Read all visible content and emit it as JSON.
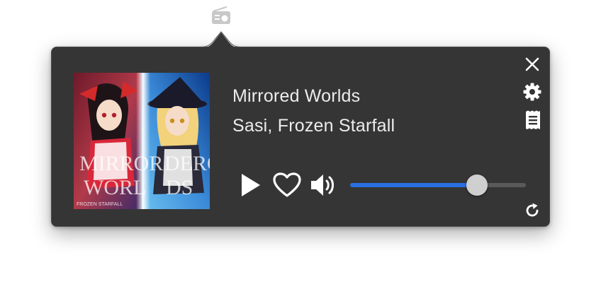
{
  "menubar": {
    "icon": "radio-icon"
  },
  "player": {
    "album_art": {
      "icon": "album-art",
      "text_left": "MIRROR",
      "text_right": "DERO",
      "text_bottom_left": "WORL",
      "text_bottom_right": "DS",
      "label": "FROZEN STARFALL"
    },
    "track_title": "Mirrored Worlds",
    "track_artist": "Sasi, Frozen Starfall",
    "controls": {
      "play_icon": "play-icon",
      "like_icon": "heart-icon",
      "volume_icon": "speaker-icon"
    },
    "volume": {
      "fraction": 0.72
    },
    "side_actions": {
      "close_icon": "close-icon",
      "settings_icon": "gear-icon",
      "log_icon": "receipt-icon",
      "refresh_icon": "refresh-icon"
    }
  },
  "colors": {
    "panel": "#353535",
    "text": "#ececec",
    "accent": "#2a6fe3",
    "icon": "#ffffff"
  }
}
